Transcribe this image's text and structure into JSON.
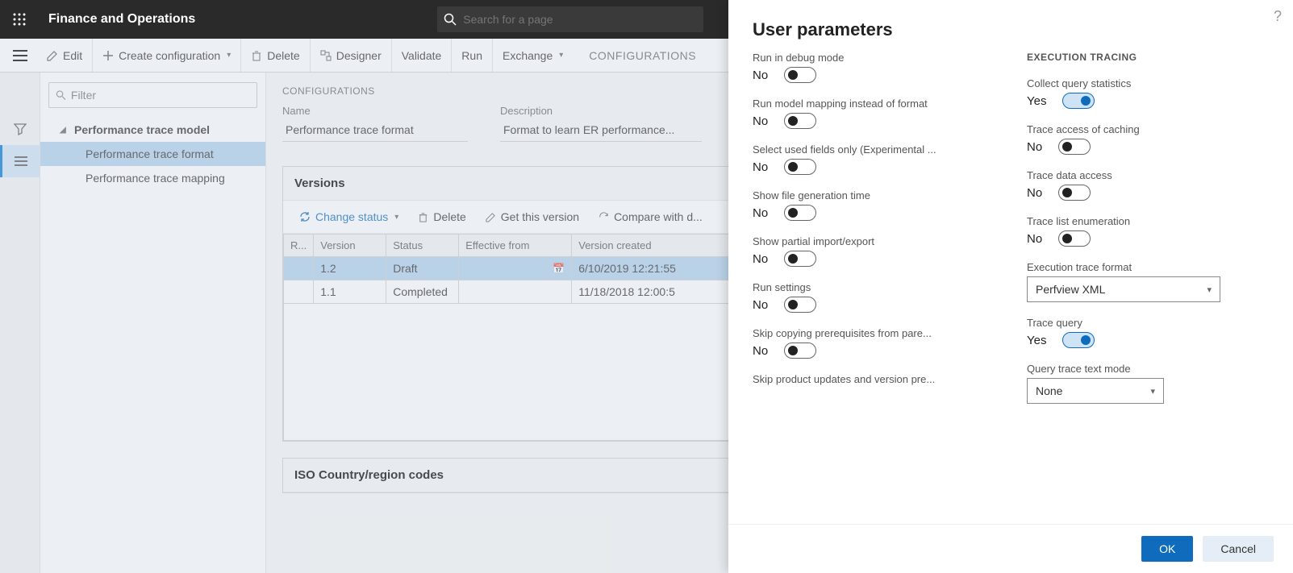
{
  "header": {
    "brand": "Finance and Operations",
    "search_placeholder": "Search for a page"
  },
  "actionbar": {
    "edit": "Edit",
    "create": "Create configuration",
    "delete": "Delete",
    "designer": "Designer",
    "validate": "Validate",
    "run": "Run",
    "exchange": "Exchange",
    "tab": "CONFIGURATIONS"
  },
  "side": {
    "filter_placeholder": "Filter",
    "tree": {
      "root": "Performance trace model",
      "child1": "Performance trace format",
      "child2": "Performance trace mapping"
    }
  },
  "content": {
    "section": "CONFIGURATIONS",
    "name_label": "Name",
    "name_value": "Performance trace format",
    "desc_label": "Description",
    "desc_value": "Format to learn ER performance...",
    "versions": {
      "title": "Versions",
      "change_status": "Change status",
      "delete": "Delete",
      "get": "Get this version",
      "compare": "Compare with d...",
      "cols": {
        "r": "R...",
        "v": "Version",
        "s": "Status",
        "e": "Effective from",
        "c": "Version created"
      },
      "rows": [
        {
          "v": "1.2",
          "s": "Draft",
          "e": "",
          "c": "6/10/2019 12:21:55"
        },
        {
          "v": "1.1",
          "s": "Completed",
          "e": "",
          "c": "11/18/2018 12:00:5"
        }
      ]
    },
    "iso_title": "ISO Country/region codes"
  },
  "panel": {
    "title": "User parameters",
    "left": {
      "debug": {
        "label": "Run in debug mode",
        "val": "No"
      },
      "modelmap": {
        "label": "Run model mapping instead of format",
        "val": "No"
      },
      "usedfields": {
        "label": "Select used fields only (Experimental ...",
        "val": "No"
      },
      "filegen": {
        "label": "Show file generation time",
        "val": "No"
      },
      "partial": {
        "label": "Show partial import/export",
        "val": "No"
      },
      "runset": {
        "label": "Run settings",
        "val": "No"
      },
      "skipcopy": {
        "label": "Skip copying prerequisites from pare...",
        "val": "No"
      },
      "skipprod": {
        "label": "Skip product updates and version pre..."
      }
    },
    "right": {
      "section": "EXECUTION TRACING",
      "collect": {
        "label": "Collect query statistics",
        "val": "Yes"
      },
      "caching": {
        "label": "Trace access of caching",
        "val": "No"
      },
      "dataacc": {
        "label": "Trace data access",
        "val": "No"
      },
      "listenum": {
        "label": "Trace list enumeration",
        "val": "No"
      },
      "format": {
        "label": "Execution trace format",
        "val": "Perfview XML"
      },
      "tracequery": {
        "label": "Trace query",
        "val": "Yes"
      },
      "textmode": {
        "label": "Query trace text mode",
        "val": "None"
      }
    },
    "ok": "OK",
    "cancel": "Cancel"
  }
}
